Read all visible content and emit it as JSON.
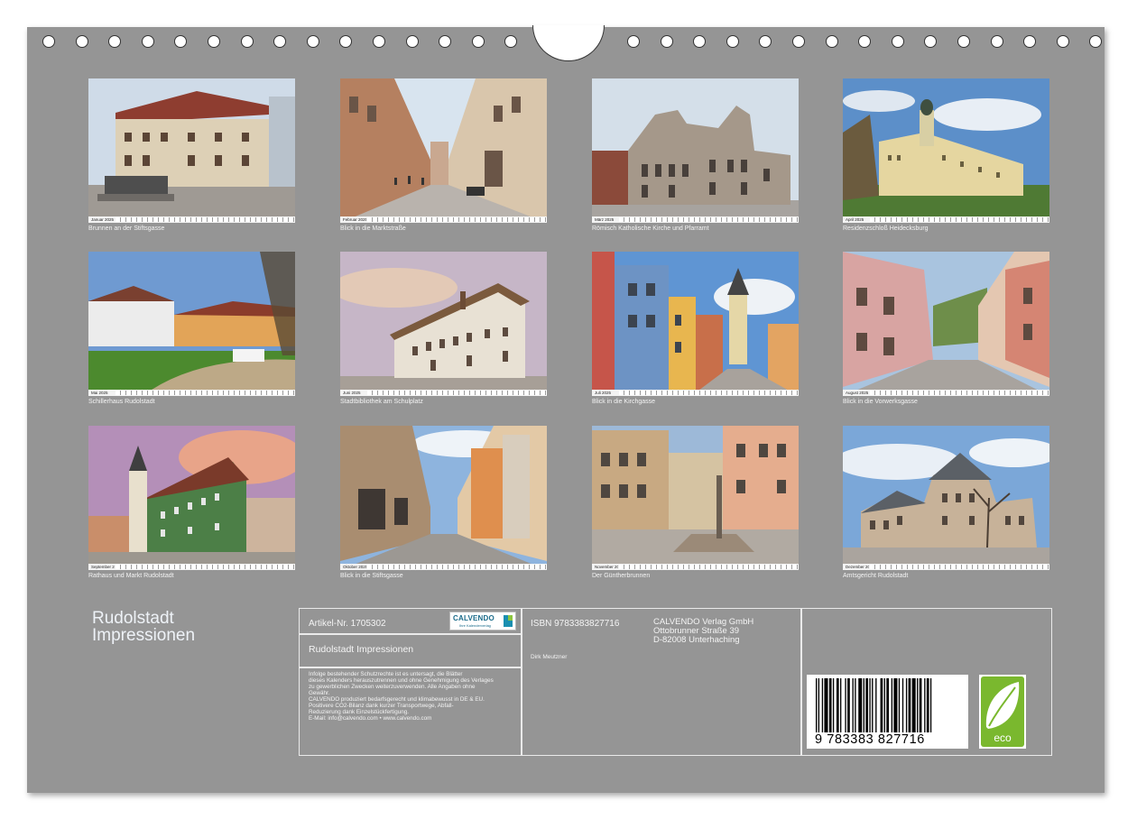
{
  "calendar": {
    "title_line1": "Rudolstadt",
    "title_line2": "Impressionen",
    "months": [
      {
        "label": "Januar 2025",
        "caption": "Brunnen an der Stiftsgasse"
      },
      {
        "label": "Februar 2025",
        "caption": "Blick in die Marktstraße"
      },
      {
        "label": "März 2025",
        "caption": "Römisch Katholische Kirche und Pfarramt"
      },
      {
        "label": "April 2025",
        "caption": "Residenzschloß Heidecksburg"
      },
      {
        "label": "Mai 2025",
        "caption": "Schillerhaus Rudolstadt"
      },
      {
        "label": "Juni 2025",
        "caption": "Stadtbibliothek am Schulplatz"
      },
      {
        "label": "Juli 2025",
        "caption": "Blick in die Kirchgasse"
      },
      {
        "label": "August 2025",
        "caption": "Blick in die Vorwerksgasse"
      },
      {
        "label": "September 2025",
        "caption": "Rathaus und Markt Rudolstadt"
      },
      {
        "label": "Oktober 2025",
        "caption": "Blick in die Stiftsgasse"
      },
      {
        "label": "November 2025",
        "caption": "Der Güntherbrunnen"
      },
      {
        "label": "Dezember 2025",
        "caption": "Amtsgericht Rudolstadt"
      }
    ]
  },
  "info": {
    "article": "Artikel-Nr. 1705302",
    "logo_text": "CALVENDO",
    "logo_sub": "Ihre Kalenderverlag",
    "product_title": "Rudolstadt Impressionen",
    "small_print": [
      "Infolge bestehender Schutzrechte ist es untersagt, die Blätter",
      "dieses Kalenders herauszutrennen und ohne Genehmigung des Verlages",
      "zu gewerblichen Zwecken weiterzuverwenden. Alle Angaben ohne",
      "Gewähr.",
      "CALVENDO produziert bedarfsgerecht und klimabewusst in DE & EU.",
      "Positivere CO2-Bilanz dank kurzer Transportwege, Abfall-",
      "Reduzierung dank Einzelstückfertigung.",
      "E-Mail: info@calvendo.com • www.calvendo.com"
    ],
    "isbn": "ISBN 9783383827716",
    "author": "Dirk Meutzner",
    "publisher_line1": "CALVENDO Verlag GmbH",
    "publisher_line2": "Ottobrunner Straße 39",
    "publisher_line3": "D-82008 Unterhaching",
    "barcode_number": "9  783383  827716",
    "eco_label": "eco"
  },
  "colors": {
    "page_bg": "#959595",
    "text_light": "#f4f4f4",
    "eco_green": "#7ab82e",
    "logo_blue": "#1a6b8a"
  }
}
